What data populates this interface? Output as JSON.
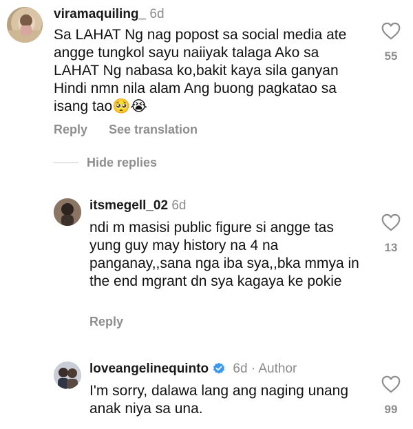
{
  "comments": [
    {
      "username": "viramaquiling_",
      "time": "6d",
      "text": "Sa LAHAT Ng nag popost sa social media ate angge tungkol sayu naiiyak talaga Ako sa LAHAT Ng nabasa ko,bakit kaya sila ganyan Hindi nmn nila alam Ang buong pagkatao sa isang tao🥺😭",
      "likes": "55",
      "reply_label": "Reply",
      "translate_label": "See translation"
    },
    {
      "username": "itsmegell_02",
      "time": "6d",
      "text": "ndi m masisi public figure si angge tas yung guy may history na 4 na panganay,,sana nga iba sya,,bka mmya in the end mgrant dn sya kagaya ke pokie",
      "likes": "13",
      "reply_label": "Reply"
    },
    {
      "username": "loveangelinequinto",
      "time": "6d",
      "author_label": "· Author",
      "text": "I'm sorry, dalawa lang ang naging unang anak niya sa una.",
      "likes": "99"
    }
  ],
  "hide_replies_label": "Hide replies",
  "colors": {
    "text": "#111111",
    "muted": "#8e8e8e",
    "verified": "#3897f0"
  },
  "icons": [
    "heart-outline-icon",
    "verified-badge-icon"
  ]
}
